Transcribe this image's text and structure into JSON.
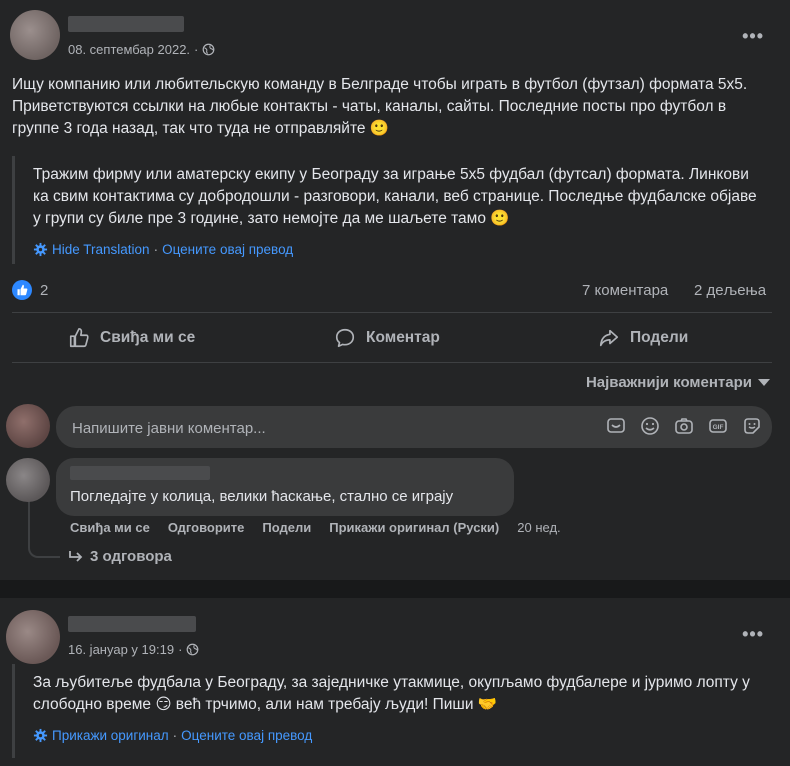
{
  "post1": {
    "date": "08. септембар 2022.",
    "sep": "·",
    "text": "Ищу компанию или любительскую команду в Белграде чтобы играть в футбол (футзал) формата 5х5. Приветствуются ссылки на любые контакты - чаты, каналы, сайты. Последние посты про футбол в группе 3 года назад, так что туда не отправляйте 🙂",
    "translation": "Тражим фирму или аматерску екипу у Београду за играње 5х5 фудбал (футсал) формата. Линкови ка свим контактима су добродошли - разговори, канали, веб странице. Последње фудбалске објаве у групи су биле пре 3 године, зато немојте да ме шаљете тамо 🙂",
    "hide_translation": "Hide Translation",
    "dot": "·",
    "rate_translation": "Оцените овај превод",
    "likes": "2",
    "comments_count": "7 коментара",
    "shares_count": "2 дељења",
    "actions": {
      "like": "Свиђа ми се",
      "comment": "Коментар",
      "share": "Подели"
    },
    "sort_label": "Најважнији коментари",
    "input_placeholder": "Напишите јавни коментар...",
    "comment": {
      "text": "Погледајте у колица, велики ћаскање, стално се играју",
      "like": "Свиђа ми се",
      "reply": "Одговорите",
      "share": "Подели",
      "show_original": "Прикажи оригинал (Руски)",
      "time": "20 нед."
    },
    "replies": "3 одговора"
  },
  "post2": {
    "date": "16. јануар у 19:19",
    "sep": "·",
    "text": "За љубитеље фудбала у Београду, за заједничке утакмице, окупљамо фудбалере и јуримо лопту у слободно време 😏 већ трчимо, али нам требају људи! Пиши 🤝",
    "show_original": "Прикажи оригинал",
    "dot": "·",
    "rate_translation": "Оцените овај превод"
  },
  "icons": {
    "globe": "globe-icon",
    "more": "more-options-icon",
    "gear": "gear-icon",
    "like": "thumbs-up-icon",
    "comment": "comment-icon",
    "share": "share-icon",
    "caret": "caret-down-icon",
    "reply": "reply-arrow-icon"
  },
  "colors": {
    "accent": "#4599ff",
    "like_blue": "#2d88ff"
  }
}
